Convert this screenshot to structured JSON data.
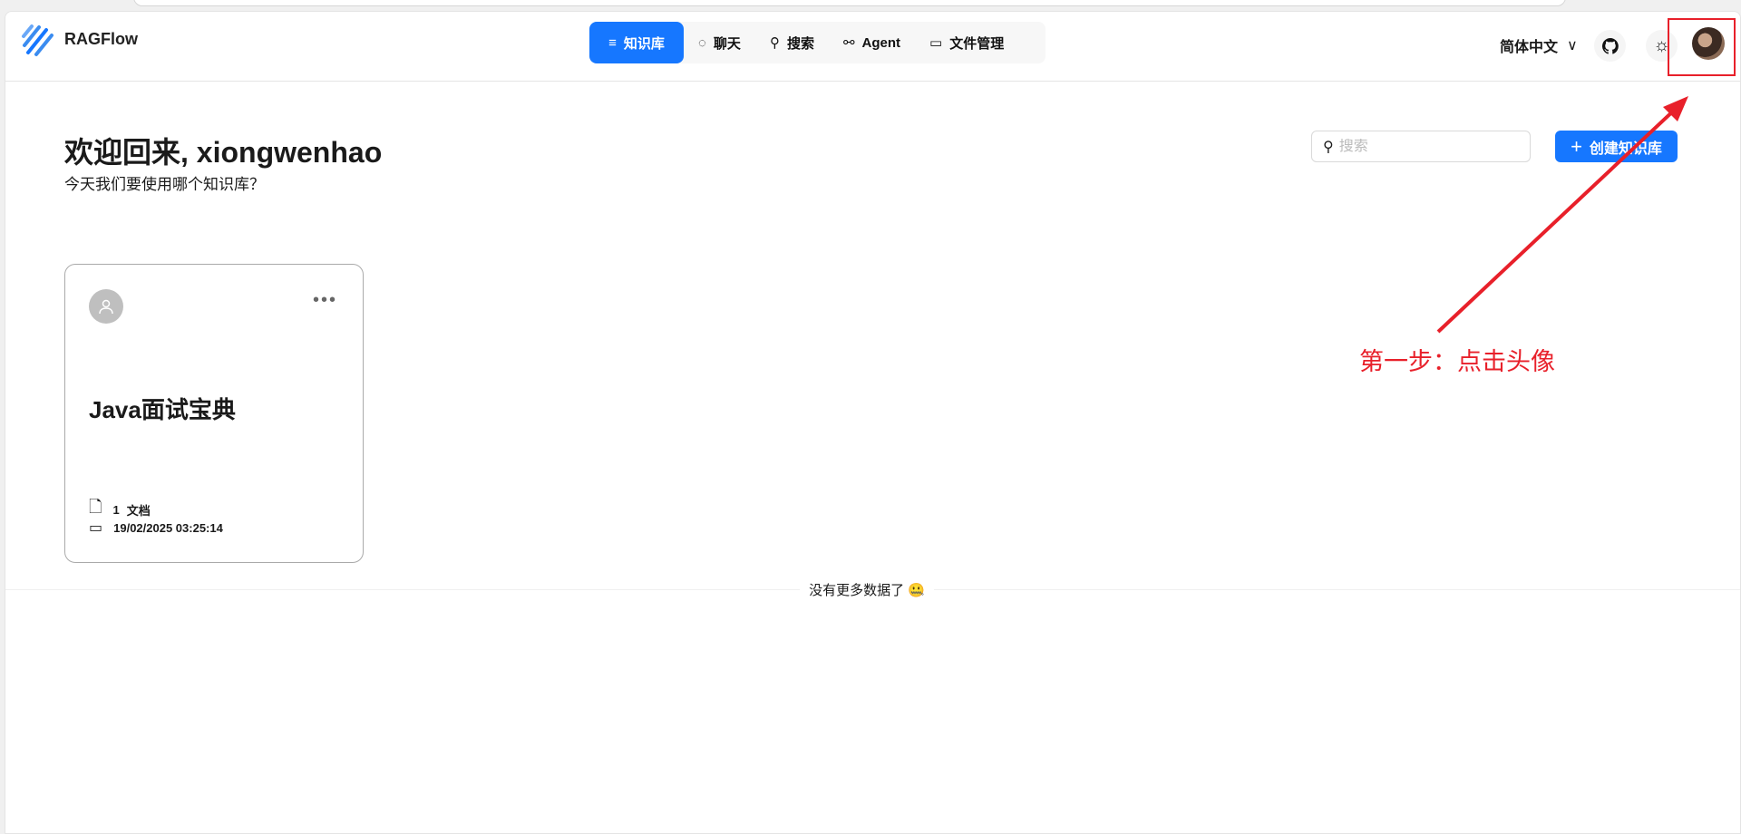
{
  "header": {
    "brand": "RAGFlow",
    "nav": [
      {
        "label": "知识库",
        "icon": "database-icon",
        "active": true
      },
      {
        "label": "聊天",
        "icon": "chat-icon"
      },
      {
        "label": "搜索",
        "icon": "search-icon"
      },
      {
        "label": "Agent",
        "icon": "agent-icon"
      },
      {
        "label": "文件管理",
        "icon": "folder-icon"
      }
    ],
    "language": "简体中文"
  },
  "main": {
    "title": "欢迎回来, xiongwenhao",
    "subtitle": "今天我们要使用哪个知识库？",
    "search_placeholder": "搜索",
    "create_label": "创建知识库",
    "cards": [
      {
        "title": "Java面试宝典",
        "doc_count": "1",
        "doc_unit": "文档",
        "date": "19/02/2025 03:25:14"
      }
    ],
    "no_more": "没有更多数据了"
  },
  "annotation": {
    "text": "第一步：点击头像",
    "color": "#e8202a"
  },
  "colors": {
    "accent": "#1677ff"
  }
}
